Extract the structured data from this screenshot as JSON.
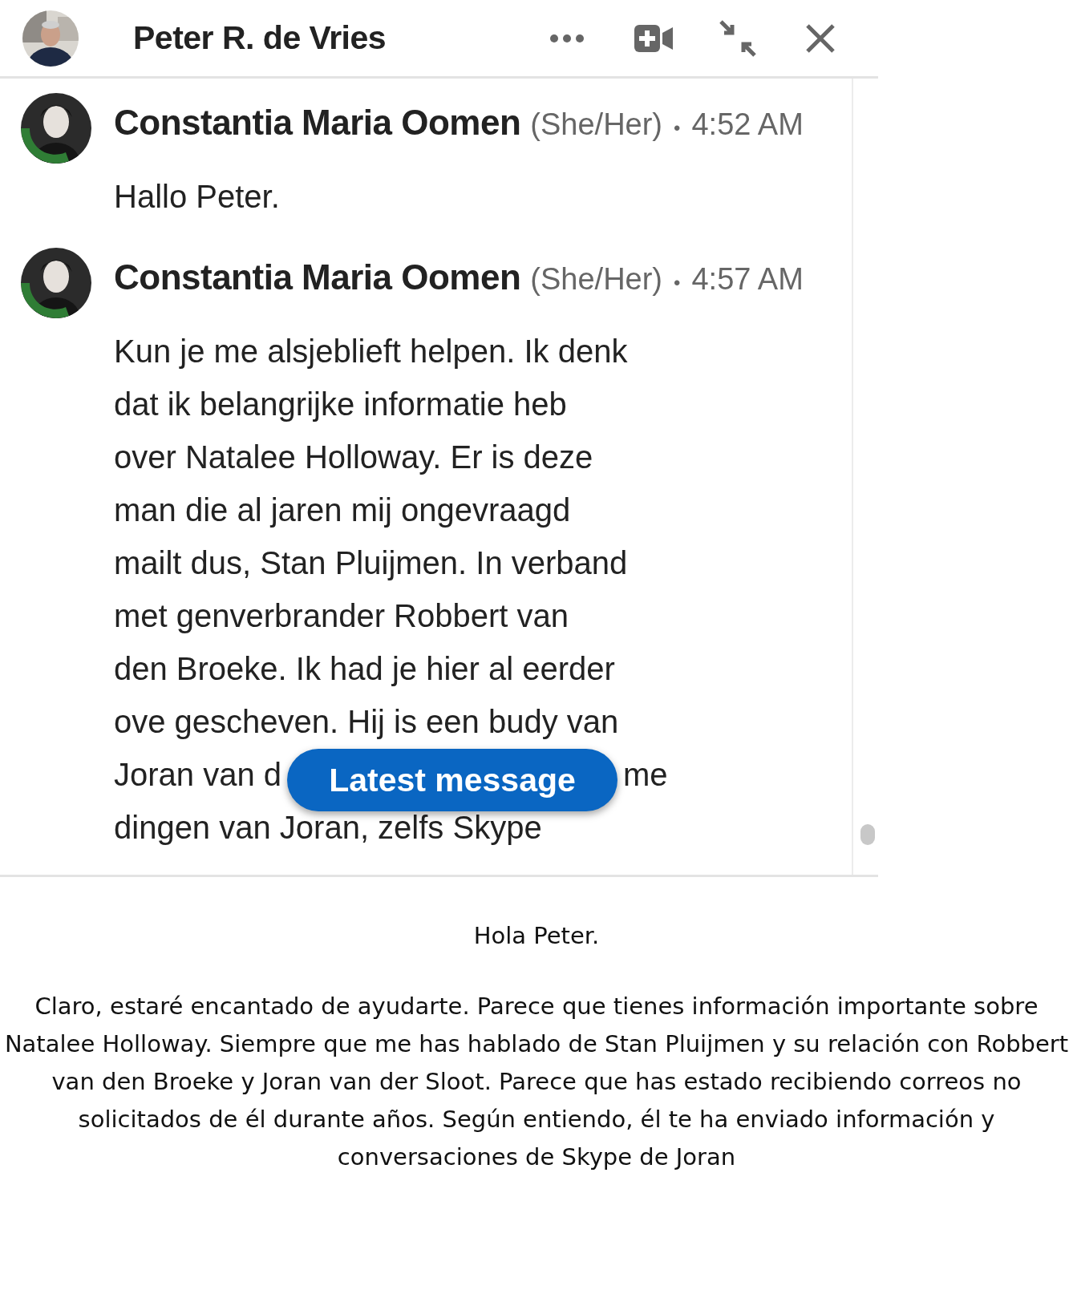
{
  "chat_header": {
    "title": "Peter R. de Vries"
  },
  "messages": [
    {
      "sender": "Constantia Maria Oomen",
      "pronouns": "(She/Her)",
      "separator": "•",
      "time": "4:52 AM",
      "lines": [
        [
          "Hallo Peter."
        ]
      ]
    },
    {
      "sender": "Constantia Maria Oomen",
      "pronouns": "(She/Her)",
      "separator": "•",
      "time": "4:57 AM",
      "lines": [
        [
          "Kun je me alsjeblieft helpen. Ik denk"
        ],
        [
          "dat ik belangrijke informatie heb"
        ],
        [
          "over Natalee Holloway. Er is deze"
        ],
        [
          "man die al jaren mij ongevraagd"
        ],
        [
          "mailt dus, Stan Pluijmen. In verband"
        ],
        [
          "met genverbrander Robbert van"
        ],
        [
          "den Broeke. Ik had je hier al eerder"
        ],
        [
          "ove gescheven. Hij is een budy van"
        ],
        [
          "Joran van d",
          "me"
        ],
        [
          "dingen van Joran, zelfs Skype"
        ]
      ]
    }
  ],
  "latest_button": "Latest message",
  "translation": {
    "greeting": "Hola Peter.",
    "body": "Claro, estaré encantado de ayudarte. Parece que tienes información importante sobre Natalee Holloway. Siempre que me has hablado de Stan Pluijmen y su relación con Robbert van den Broeke y Joran van der Sloot. Parece que has estado recibiendo correos no solicitados de él durante años. Según entiendo, él te ha enviado información y conversaciones de Skype de Joran"
  }
}
